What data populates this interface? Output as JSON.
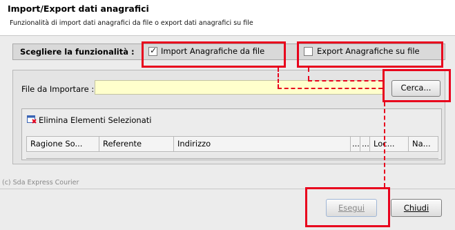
{
  "header": {
    "title": "Import/Export dati anagrafici",
    "subtitle": "Funzionalità di import dati anagrafici da file o export dati anagrafici su file"
  },
  "functionality": {
    "label": "Scegliere la funzionalità :",
    "import_option": {
      "label": "Import Anagrafiche da file",
      "checked": true
    },
    "export_option": {
      "label": "Export Anagrafiche su file",
      "checked": false
    }
  },
  "file": {
    "label": "File da Importare :",
    "value": "",
    "browse_button": "Cerca..."
  },
  "grid": {
    "delete_action": "Elimina Elementi Selezionati",
    "columns": [
      "Ragione So...",
      "Referente",
      "Indirizzo",
      "...",
      "...",
      "Loc...",
      "Na..."
    ]
  },
  "footer": {
    "copyright": "(c) Sda Express Courier",
    "execute_button": "Esegui",
    "close_button": "Chiudi"
  },
  "colors": {
    "highlight": "#e8001c",
    "input_background": "#ffffcc"
  },
  "icons": {
    "check": "check-icon",
    "delete": "delete-rows-icon"
  }
}
